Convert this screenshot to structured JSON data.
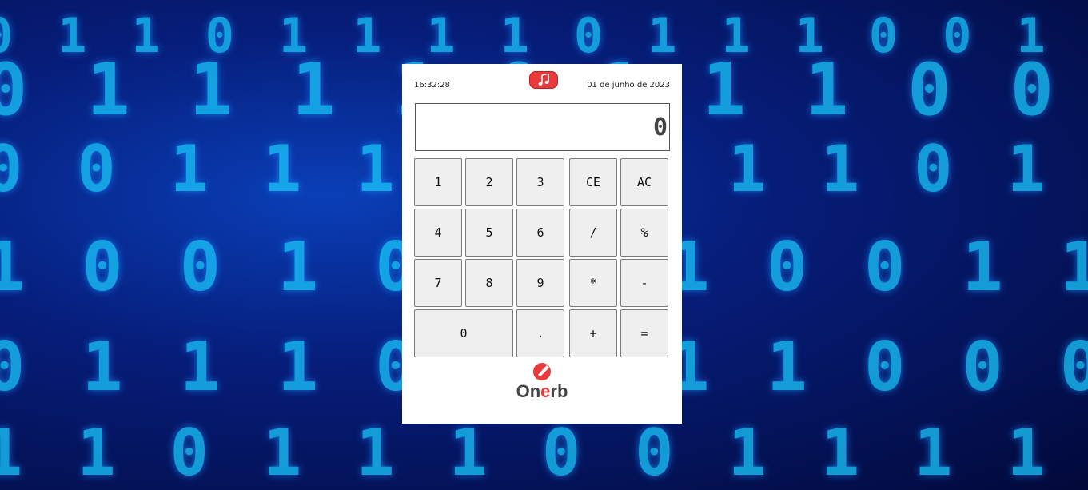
{
  "calculator": {
    "time": "16:32:28",
    "date": "01 de junho de 2023",
    "display": "0",
    "keys": {
      "k1": "1",
      "k2": "2",
      "k3": "3",
      "ce": "CE",
      "ac": "AC",
      "k4": "4",
      "k5": "5",
      "k6": "6",
      "divide": "/",
      "percent": "%",
      "k7": "7",
      "k8": "8",
      "k9": "9",
      "multiply": "*",
      "minus": "-",
      "k0": "0",
      "dot": ".",
      "plus": "+",
      "equals": "="
    }
  },
  "brand": {
    "logo_prefix": "On",
    "logo_accent": "e",
    "logo_suffix": "rb"
  },
  "colors": {
    "accent": "#e83a3a",
    "key_bg": "#efefef"
  },
  "icons": {
    "music": "music-note-icon",
    "logo": "pen-bubble-icon"
  }
}
